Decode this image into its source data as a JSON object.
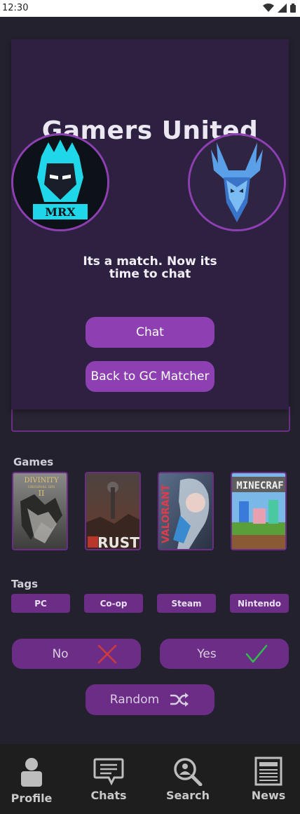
{
  "status_bar": {
    "time": "12:30"
  },
  "match_dialog": {
    "title": "Gamers United",
    "message": "Its a match. Now its time to chat",
    "chat_button": "Chat",
    "back_button": "Back to GC Matcher",
    "left_avatar_text": "MRX"
  },
  "games": {
    "label": "Games",
    "cards": [
      {
        "name": "Divinity Original Sin II",
        "text_line1": "DIVINITY",
        "text_line2": "ORIGINAL SIN",
        "text_line3": "II"
      },
      {
        "name": "Rust",
        "text": "RUST"
      },
      {
        "name": "Valorant",
        "text": "VALORANT"
      },
      {
        "name": "Minecraft",
        "text": "MINECRAF"
      }
    ]
  },
  "tags": {
    "label": "Tags",
    "items": [
      "PC",
      "Co-op",
      "Steam",
      "Nintendo"
    ]
  },
  "actions": {
    "no": "No",
    "yes": "Yes",
    "random": "Random"
  },
  "nav": {
    "items": [
      {
        "label": "Profile",
        "icon": "person-icon"
      },
      {
        "label": "Chats",
        "icon": "chat-bubble-icon"
      },
      {
        "label": "Search",
        "icon": "search-person-icon"
      },
      {
        "label": "News",
        "icon": "newspaper-icon"
      }
    ]
  },
  "colors": {
    "background": "#24212f",
    "dialog": "#2d2040",
    "accent": "#8e3fb2",
    "accent_dark": "#6b2d86",
    "nav": "#1e1e1e",
    "no_icon": "#d23a3a",
    "yes_icon": "#2fbf4a"
  }
}
